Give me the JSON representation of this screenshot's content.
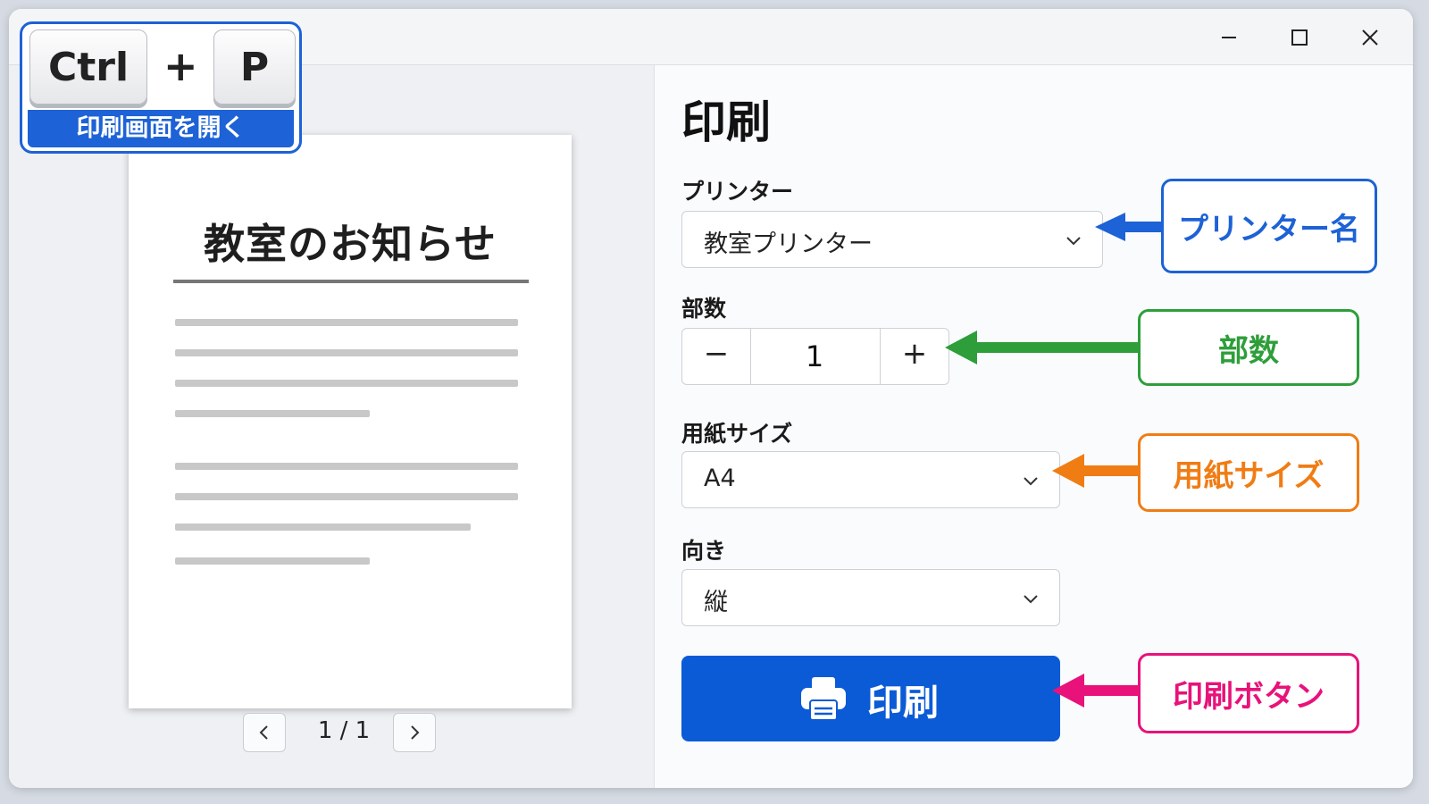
{
  "window": {
    "controls": {
      "minimize": "minimize-icon",
      "maximize": "maximize-icon",
      "close": "close-icon"
    }
  },
  "shortcut": {
    "key1": "Ctrl",
    "plus": "+",
    "key2": "P",
    "caption": "印刷画面を開く"
  },
  "preview": {
    "document_title": "教室のお知らせ",
    "page_indicator": "1 / 1",
    "prev_icon": "chevron-left-icon",
    "next_icon": "chevron-right-icon"
  },
  "settings": {
    "heading": "印刷",
    "printer": {
      "label": "プリンター",
      "value": "教室プリンター"
    },
    "copies": {
      "label": "部数",
      "value": "1",
      "minus": "−",
      "plus": "+"
    },
    "paper_size": {
      "label": "用紙サイズ",
      "value": "A4"
    },
    "orientation": {
      "label": "向き",
      "value": "縦"
    },
    "print_button": {
      "label": "印刷",
      "icon": "printer-icon"
    }
  },
  "annotations": {
    "printer_name": {
      "text": "プリンター名",
      "color": "#1d62d6"
    },
    "copies": {
      "text": "部数",
      "color": "#2e9e3a"
    },
    "paper_size": {
      "text": "用紙サイズ",
      "color": "#f07c14"
    },
    "print_button": {
      "text": "印刷ボタン",
      "color": "#e8127a"
    }
  },
  "colors": {
    "accent": "#0b5bd7"
  }
}
